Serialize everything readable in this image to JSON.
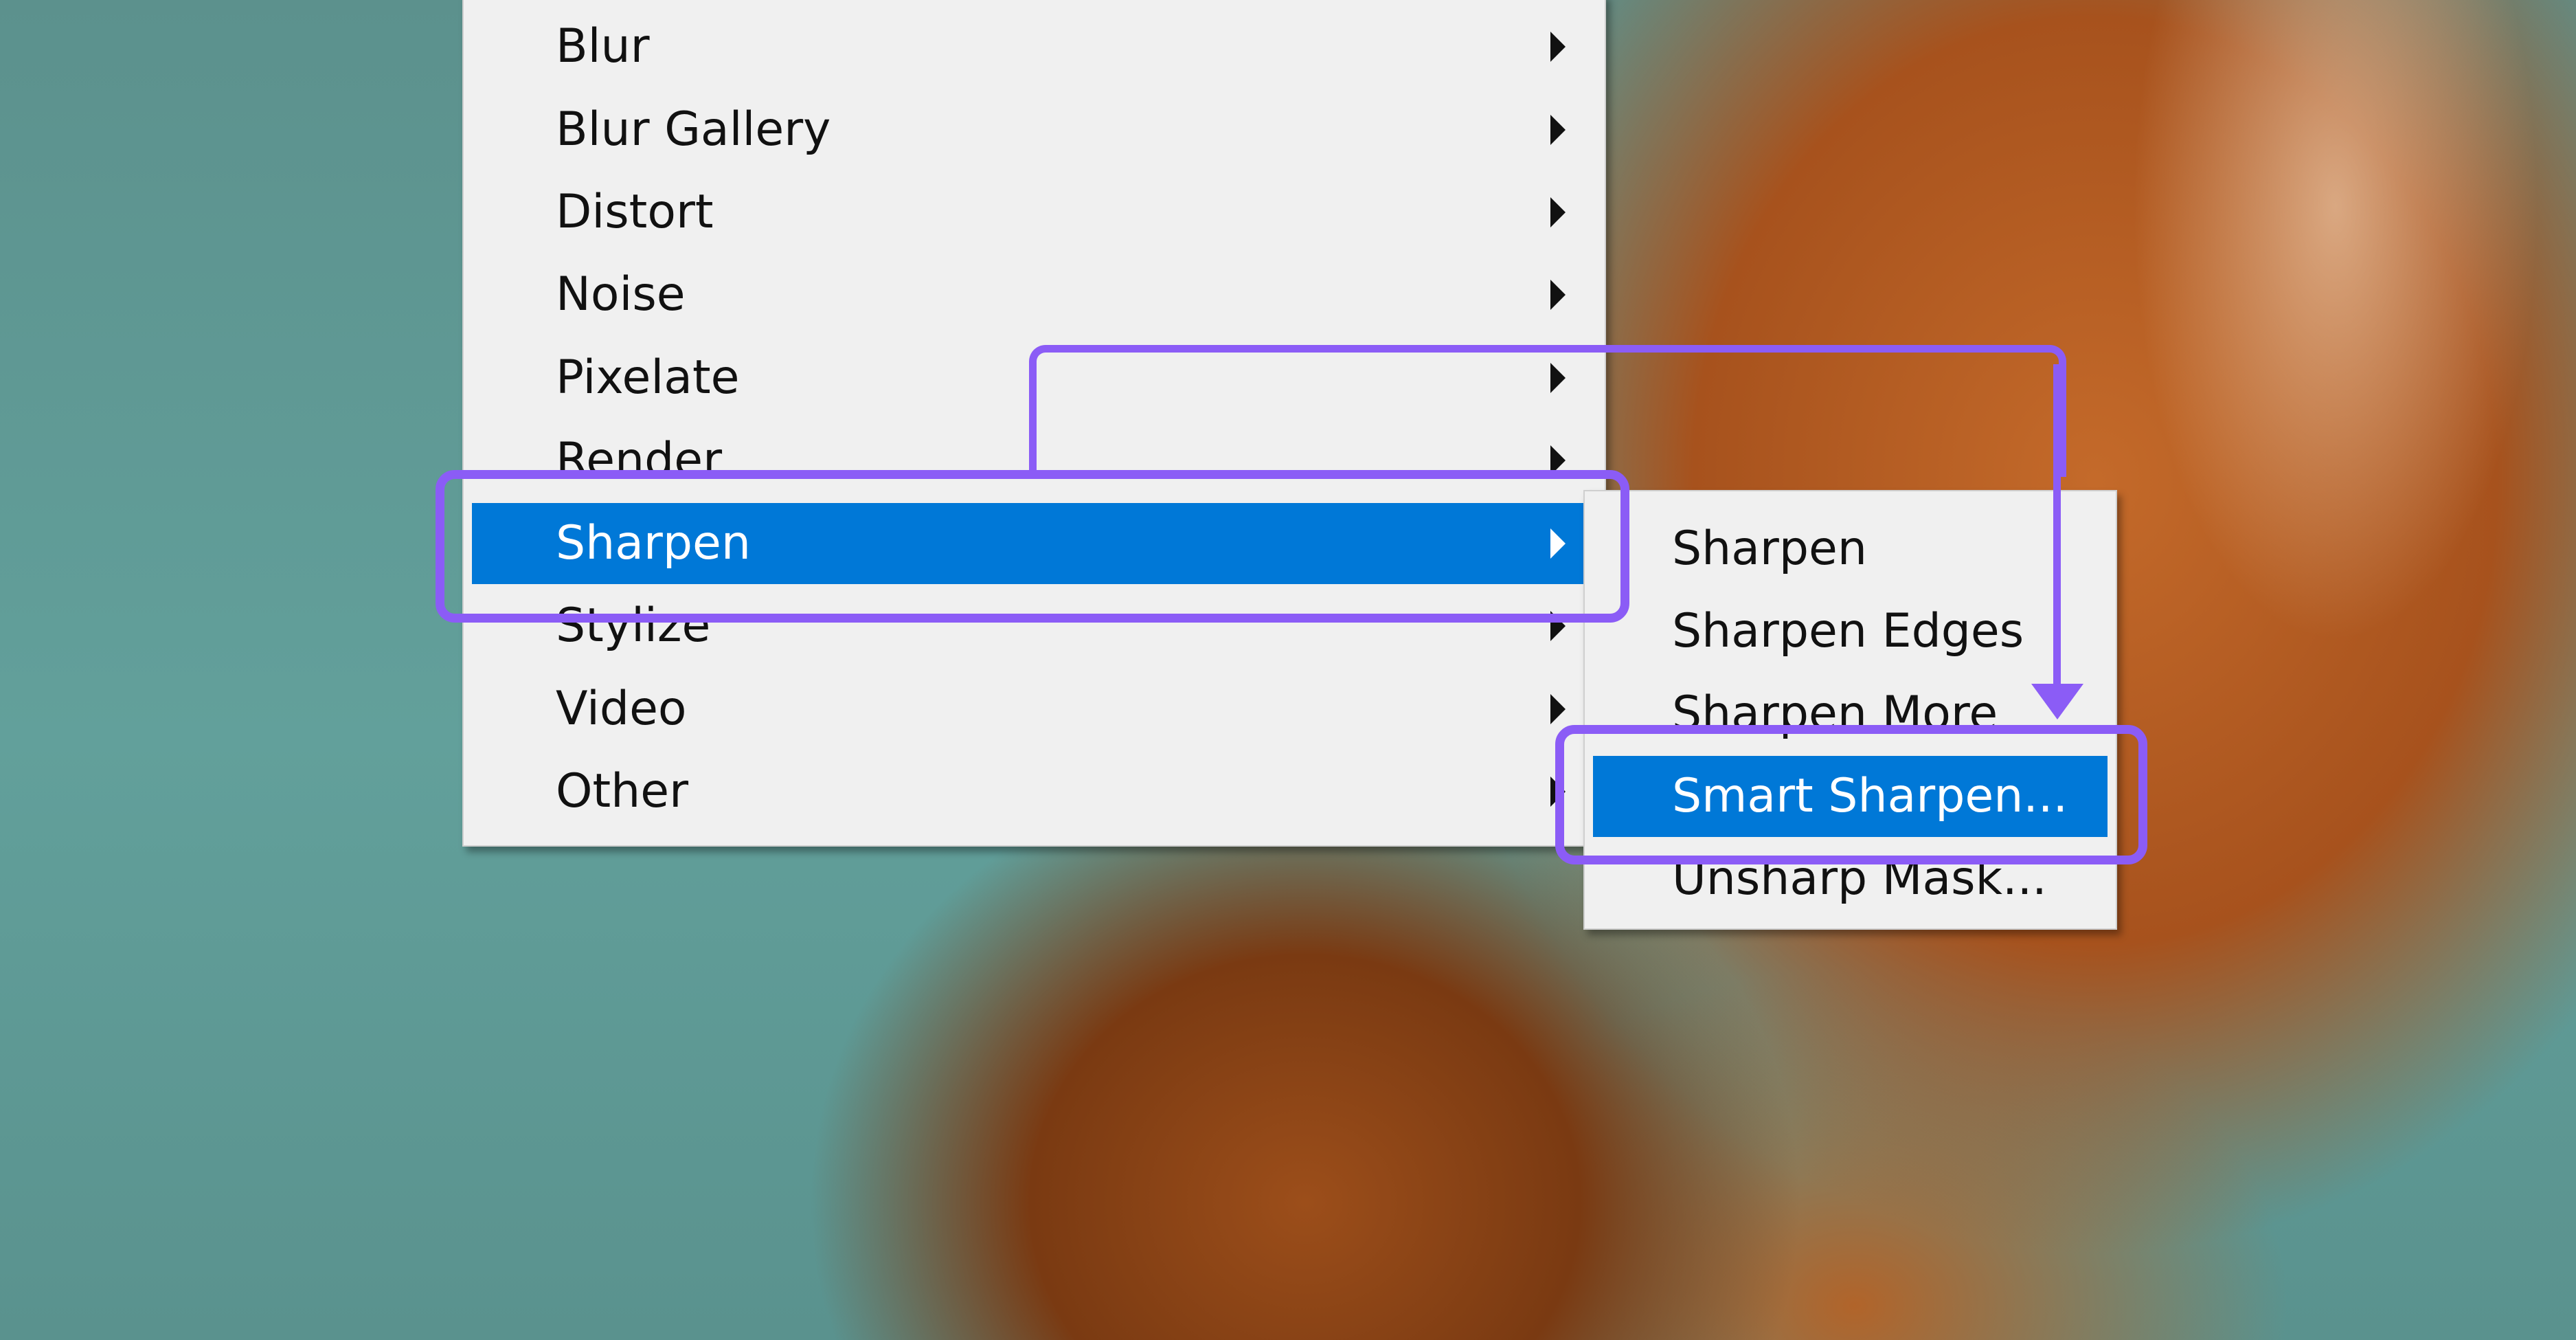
{
  "filter_menu": {
    "items": [
      {
        "label": "Blur",
        "has_submenu": true
      },
      {
        "label": "Blur Gallery",
        "has_submenu": true
      },
      {
        "label": "Distort",
        "has_submenu": true
      },
      {
        "label": "Noise",
        "has_submenu": true
      },
      {
        "label": "Pixelate",
        "has_submenu": true
      },
      {
        "label": "Render",
        "has_submenu": true
      },
      {
        "label": "Sharpen",
        "has_submenu": true,
        "selected": true
      },
      {
        "label": "Stylize",
        "has_submenu": true
      },
      {
        "label": "Video",
        "has_submenu": true
      },
      {
        "label": "Other",
        "has_submenu": true
      }
    ]
  },
  "sharpen_submenu": {
    "items": [
      {
        "label": "Sharpen"
      },
      {
        "label": "Sharpen Edges"
      },
      {
        "label": "Sharpen More"
      },
      {
        "label": "Smart Sharpen...",
        "selected": true
      },
      {
        "label": "Unsharp Mask..."
      }
    ]
  },
  "colors": {
    "menu_background": "#f0f0f0",
    "selection": "#0078d7",
    "annotation": "#8b5cf6"
  },
  "icons": {
    "submenu_arrow": "chevron-right-icon",
    "annotation_arrow": "arrow-down-icon"
  }
}
